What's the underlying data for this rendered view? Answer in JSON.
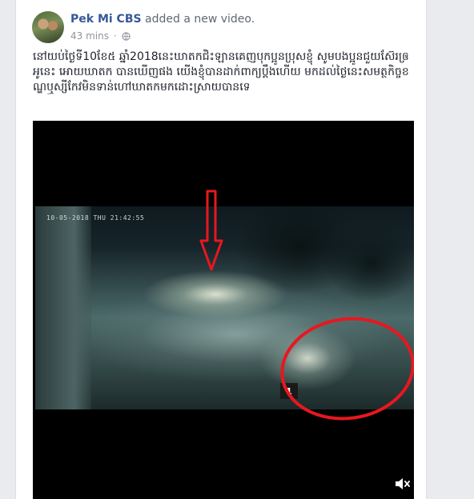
{
  "post": {
    "author": "Pek Mi CBS",
    "action": "added a new video.",
    "timestamp": "43 mins",
    "privacy_icon": "globe-icon",
    "text": "នៅយប់ថ្ងៃទី10ខែ៥ ឆ្នាំ2018នេះឃាតកជិះឡានគេញបុកប្អូនប្រុសខ្ញុំ សូមបងប្អូនជួយស៊ែរឲ្រអូនេះ អោយឃាតក បានឃើញផង យើងខ្ញុំបានដាក់ពាក្យប្ដឹងហើយ មកដល់ថ្ងៃនេះសមត្ថកិច្ចខណ្ឌឬស្សីកែវមិនទាន់ហៅឃាតកមកដោះស្រាយបានទេ"
  },
  "video": {
    "overlay_timestamp": "10-05-2018 THU 21:42:55",
    "channel_number": "1",
    "annotation_color": "#e8171f",
    "mute_icon": "speaker-mute-icon"
  },
  "colors": {
    "author_link": "#365899",
    "meta_gray": "#90949c",
    "page_bg": "#e9ebee"
  }
}
